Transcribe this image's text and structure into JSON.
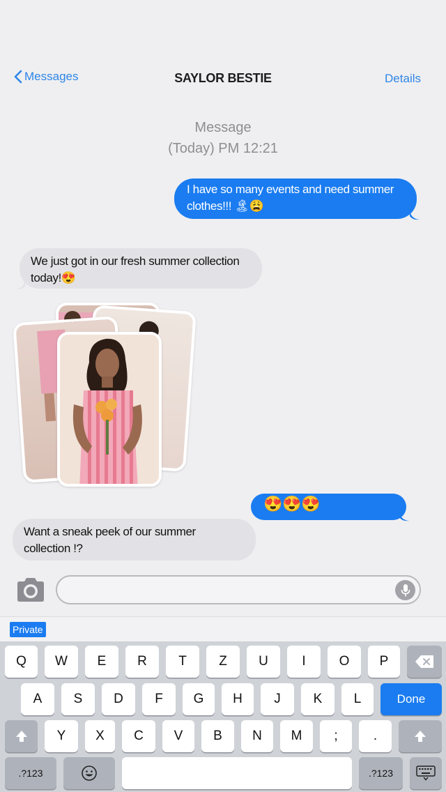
{
  "nav": {
    "back_label": "Messages",
    "title": "SAYLOR BESTIE",
    "details_label": "Details"
  },
  "timestamp": {
    "line1": "Message",
    "line2": "(Today) PM 12:21"
  },
  "messages": [
    {
      "direction": "outgoing",
      "text": "I have so many events and need summer clothes!!! 🏝😩"
    },
    {
      "direction": "incoming",
      "text": "We just got in our fresh summer collection today!😍"
    },
    {
      "direction": "incoming",
      "type": "photo-stack",
      "count": 4
    },
    {
      "direction": "outgoing",
      "text": "😍😍😍"
    },
    {
      "direction": "incoming",
      "text": "Want a sneak peek of our summer collection !?"
    }
  ],
  "composer": {
    "placeholder": ""
  },
  "predictive": {
    "badge": "Private"
  },
  "keyboard": {
    "row1": [
      "Q",
      "W",
      "E",
      "R",
      "T",
      "Z",
      "U",
      "I",
      "O",
      "P"
    ],
    "row2": [
      "A",
      "S",
      "D",
      "F",
      "G",
      "H",
      "J",
      "K",
      "L"
    ],
    "done_label": "Done",
    "row3": [
      "Y",
      "X",
      "C",
      "V",
      "B",
      "N",
      "M",
      ";",
      "."
    ],
    "numbers_label": ".?123"
  },
  "colors": {
    "accent": "#1a7cf0",
    "incoming_bubble": "#e2e2e6",
    "link": "#2f86e6"
  }
}
